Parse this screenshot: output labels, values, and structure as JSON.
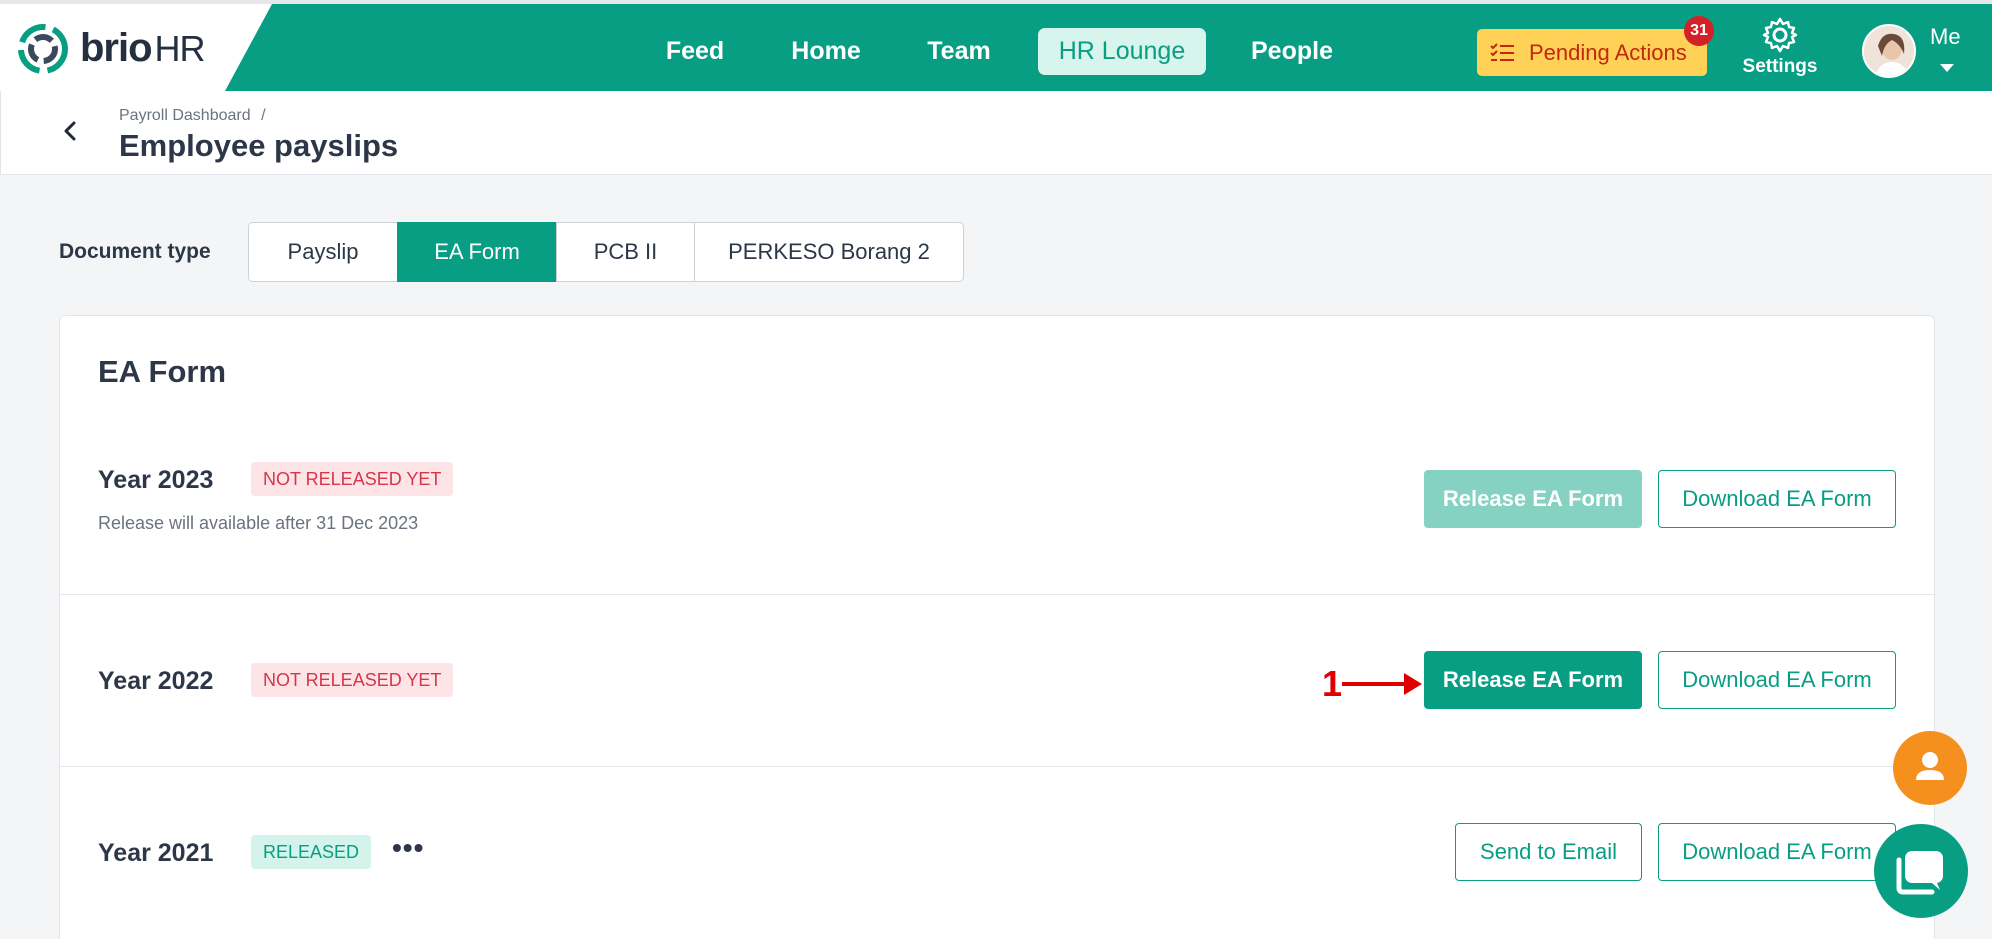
{
  "brand": {
    "name": "brio",
    "suffix": "HR",
    "color": "#079e84"
  },
  "nav": {
    "items": [
      {
        "label": "Feed"
      },
      {
        "label": "Home"
      },
      {
        "label": "Team"
      },
      {
        "label": "HR Lounge",
        "active": true
      },
      {
        "label": "People"
      }
    ],
    "pending": {
      "label": "Pending Actions",
      "count": "31",
      "icon": "checklist-icon"
    },
    "settings": {
      "label": "Settings",
      "icon": "gear-icon"
    },
    "user": {
      "label": "Me"
    }
  },
  "breadcrumb": {
    "parent": "Payroll Dashboard",
    "separator": "/"
  },
  "page": {
    "title": "Employee payslips"
  },
  "document_type": {
    "label": "Document type",
    "options": [
      {
        "label": "Payslip"
      },
      {
        "label": "EA Form",
        "selected": true
      },
      {
        "label": "PCB II"
      },
      {
        "label": "PERKESO Borang 2"
      }
    ]
  },
  "card": {
    "title": "EA Form",
    "rows": [
      {
        "year": "Year 2023",
        "status": "NOT RELEASED YET",
        "note": "Release will available after 31 Dec 2023",
        "primary_label": "Release EA Form",
        "primary_state": "disabled",
        "secondary_label": "Download EA Form"
      },
      {
        "year": "Year 2022",
        "status": "NOT RELEASED YET",
        "primary_label": "Release EA Form",
        "primary_state": "enabled",
        "secondary_label": "Download EA Form"
      },
      {
        "year": "Year 2021",
        "status": "RELEASED",
        "more": "•••",
        "primary_label": "Send to Email",
        "secondary_label": "Download EA Form"
      }
    ]
  },
  "annotation": {
    "number": "1",
    "color": "#e00000"
  },
  "colors": {
    "accent": "#079e84",
    "warning": "#ffd257",
    "danger": "#d42027",
    "fab": "#f5901e"
  }
}
